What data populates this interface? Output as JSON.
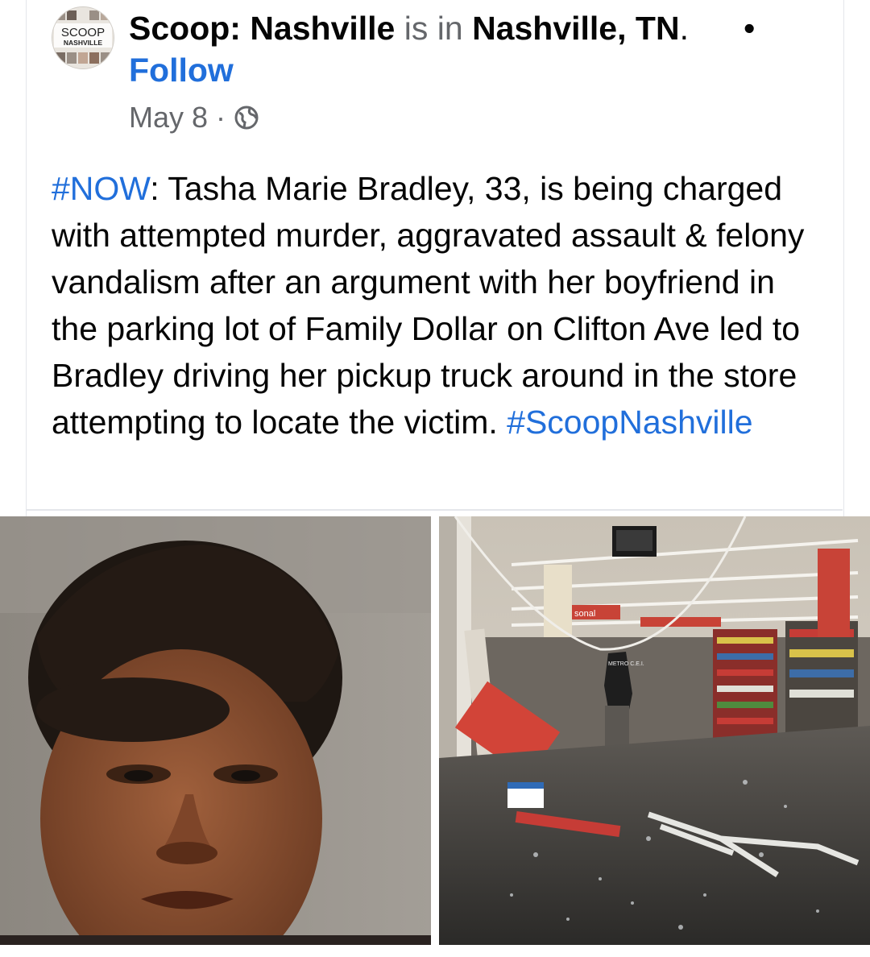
{
  "post": {
    "page_name": "Scoop: Nashville",
    "is_in": " is in ",
    "location": "Nashville, TN",
    "location_suffix": ".",
    "separator": "•",
    "follow_label": "Follow",
    "date": "May 8",
    "meta_sep": "·",
    "privacy_icon": "globe-icon",
    "avatar_text_top": "SCOOP",
    "avatar_text_bottom": "NASHVILLE",
    "text_hashtag_start": "#NOW",
    "text_body": ": Tasha Marie Bradley, 33, is being charged with attempted murder, aggravated assault & felony vandalism after an argument with her boyfriend in the parking lot of Family Dollar on Clifton Ave led to Bradley driving her pickup truck around in the store attempting to locate the victim. ",
    "text_hashtag_end": "#ScoopNashville"
  },
  "photos": {
    "right_sign_text": "sonal",
    "right_badge_text": "METRO C.E.I."
  },
  "colors": {
    "link": "#216fdb",
    "text": "#050505",
    "muted": "#65676b",
    "divider": "#e4e6eb"
  }
}
